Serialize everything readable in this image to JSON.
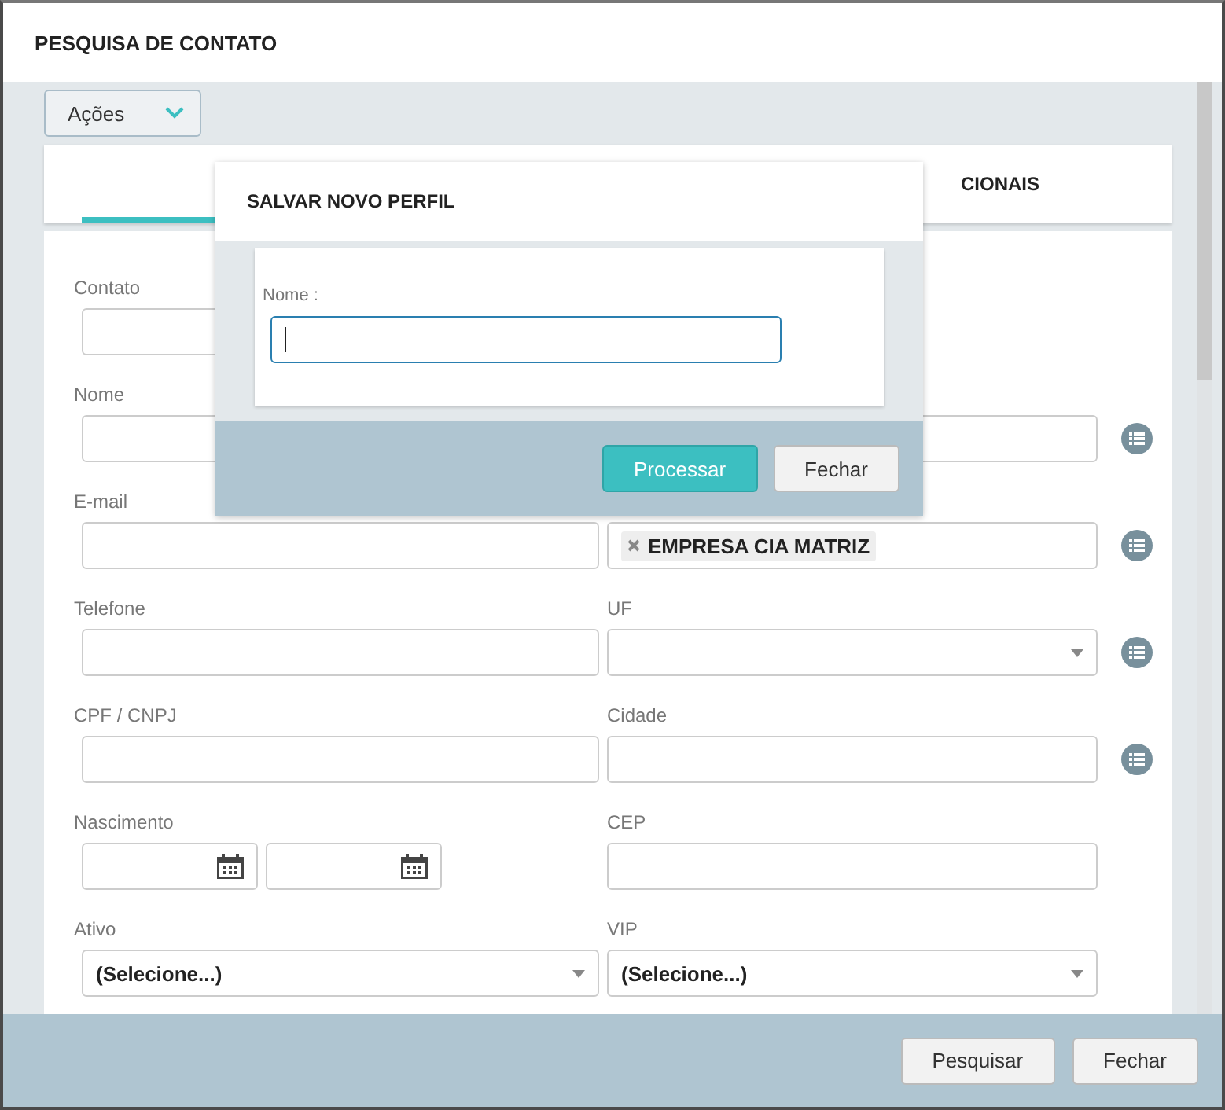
{
  "window": {
    "title": "PESQUISA DE CONTATO"
  },
  "actions_menu": {
    "label": "Ações"
  },
  "tabs": [
    {
      "selected": true
    },
    {
      "label": "CIONAIS",
      "selected": false
    }
  ],
  "rows": [
    {
      "left": {
        "label": "Contato",
        "kind": "text"
      }
    },
    {
      "left": {
        "label": "Nome",
        "kind": "text"
      },
      "right": {
        "kind": "text",
        "lookup": true
      }
    },
    {
      "left": {
        "label": "E-mail",
        "kind": "text"
      },
      "right": {
        "kind": "tags",
        "tags": [
          "EMPRESA CIA MATRIZ"
        ],
        "lookup": true
      }
    },
    {
      "left": {
        "label": "Telefone",
        "kind": "text"
      },
      "right": {
        "label": "UF",
        "kind": "select",
        "lookup": true
      }
    },
    {
      "left": {
        "label": "CPF / CNPJ",
        "kind": "text"
      },
      "right": {
        "label": "Cidade",
        "kind": "text",
        "lookup": true
      }
    },
    {
      "left": {
        "label": "Nascimento",
        "kind": "date_range"
      },
      "right": {
        "label": "CEP",
        "kind": "text",
        "lookup": false
      }
    },
    {
      "left": {
        "label": "Ativo",
        "kind": "select",
        "value": "(Selecione...)"
      },
      "right": {
        "label": "VIP",
        "kind": "select",
        "value": "(Selecione...)",
        "lookup": false
      }
    }
  ],
  "footer_buttons": [
    "Pesquisar",
    "Fechar"
  ],
  "dialog": {
    "title": "SALVAR NOVO PERFIL",
    "field_label": "Nome :",
    "focused": true,
    "buttons": [
      {
        "label": "Processar",
        "kind": "primary"
      },
      {
        "label": "Fechar",
        "kind": "default"
      }
    ]
  }
}
